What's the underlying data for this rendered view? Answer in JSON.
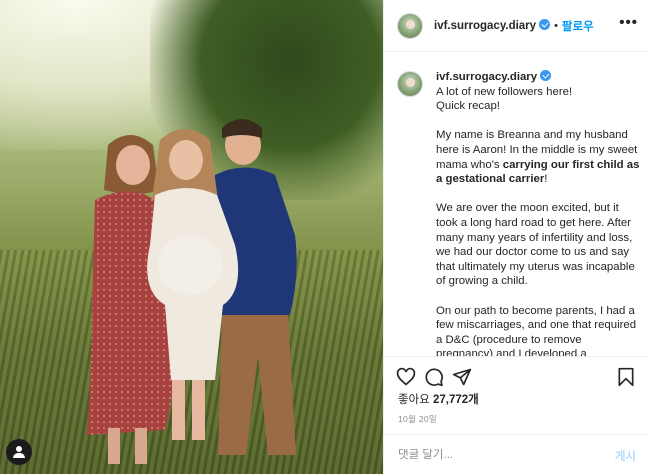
{
  "post": {
    "username": "ivf.surrogacy.diary",
    "follow_label": "팔로우",
    "separator": "•",
    "more_label": "•••"
  },
  "caption": {
    "username": "ivf.surrogacy.diary",
    "paragraphs": [
      {
        "text": "A lot of new followers here!\nQuick recap!"
      },
      {
        "before": "My name is Breanna and my husband here is Aaron! In the middle is my sweet mama who's ",
        "bold": "carrying our first child as a gestational carrier",
        "after": "!"
      },
      {
        "text": "We are over the moon excited, but it took a long hard road to get here. After many many years of infertility and loss, we had our doctor come to us and say that ultimately my uterus was incapable of growing a child."
      },
      {
        "text": "On our path to become parents, I had a few miscarriages, and one that required a D&C (procedure to remove pregnancy) and I developed a"
      }
    ]
  },
  "engagement": {
    "likes_prefix": "좋아요",
    "likes_count": "27,772",
    "likes_suffix": "개",
    "date": "10월 20일"
  },
  "comment": {
    "placeholder": "댓글 달기...",
    "post_label": "게시"
  },
  "icons": {
    "like": "heart-icon",
    "comment": "comment-icon",
    "share": "paper-plane-icon",
    "save": "bookmark-icon",
    "tags": "user-tag-icon",
    "verified": "verified-badge-icon"
  },
  "colors": {
    "accent": "#0095f6",
    "verified": "#3897f0",
    "muted": "#8e8e8e",
    "post_disabled": "#b3dbff"
  }
}
